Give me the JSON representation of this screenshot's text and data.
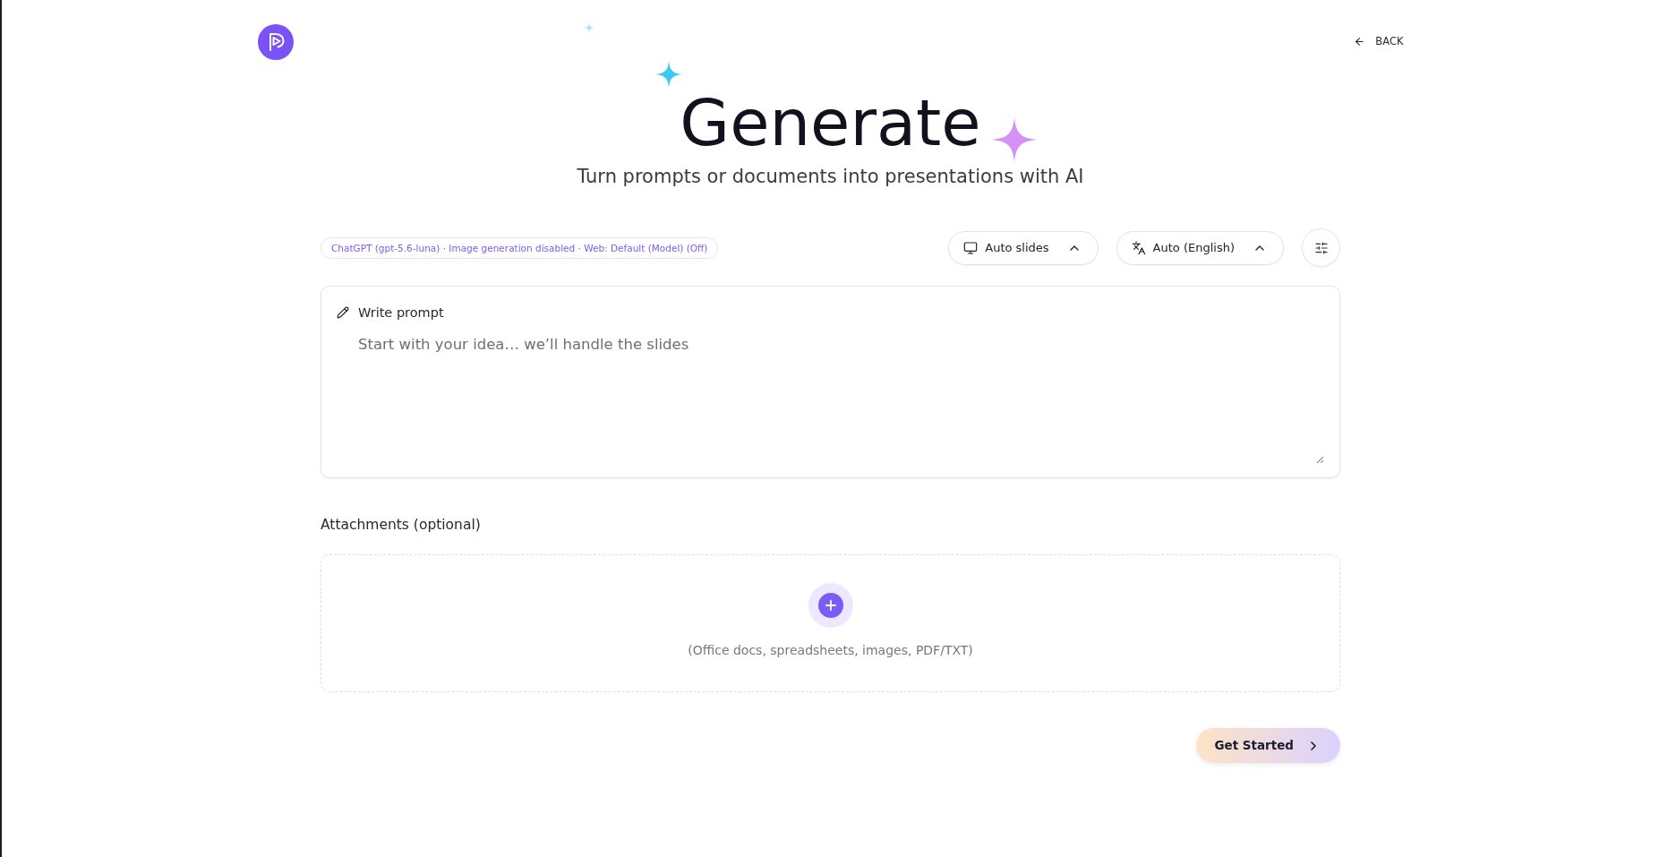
{
  "header": {
    "back_link": {
      "label": "BACK"
    }
  },
  "title": "Generate",
  "subtitle": "Turn prompts or documents into presentations with AI",
  "toolbar": {
    "model_info": "ChatGPT (gpt-5.6-luna) · Image generation disabled · Web: Default (Model) (Off)",
    "dropdowns": [
      {
        "kind": "slides",
        "label": "Auto slides"
      },
      {
        "kind": "language",
        "label": "Auto (English)"
      }
    ]
  },
  "prompt": {
    "label": "Write prompt",
    "placeholder": "Start with your idea… we’ll handle the slides"
  },
  "attachments": {
    "label": "Attachments (optional)",
    "hint": "(Office docs, spreadsheets, images, PDF/TXT)"
  },
  "primary_button": {
    "label": "Get Started"
  }
}
